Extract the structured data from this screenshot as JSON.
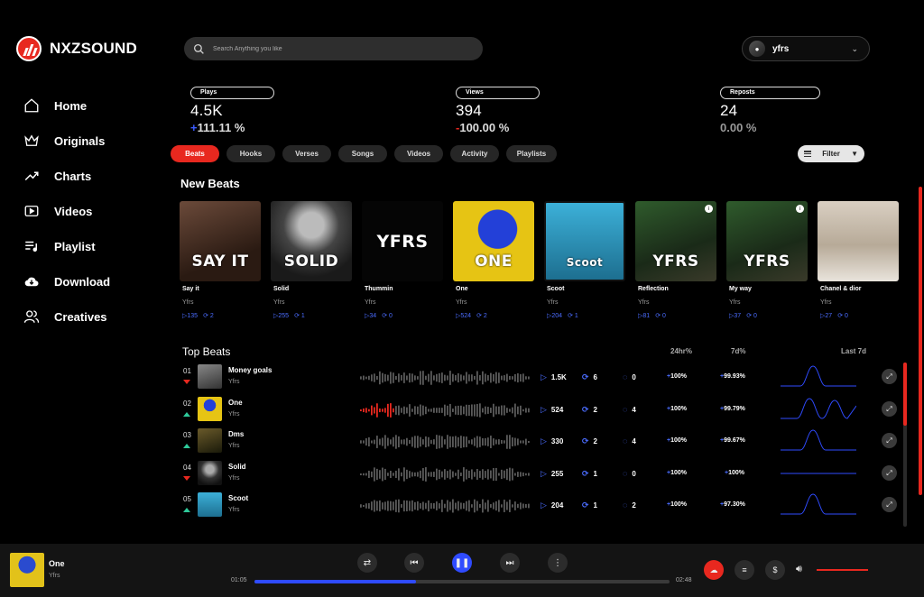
{
  "brand": {
    "name": "NXZSOUND",
    "accent": "#e8281f",
    "blue": "#2f4bff"
  },
  "nav": [
    {
      "label": "Home",
      "icon": "home-icon"
    },
    {
      "label": "Originals",
      "icon": "crown-icon"
    },
    {
      "label": "Charts",
      "icon": "trend-icon"
    },
    {
      "label": "Videos",
      "icon": "video-icon"
    },
    {
      "label": "Playlist",
      "icon": "playlist-icon"
    },
    {
      "label": "Download",
      "icon": "cloud-download-icon"
    },
    {
      "label": "Creatives",
      "icon": "people-icon"
    }
  ],
  "search": {
    "placeholder": "Search Anything you like"
  },
  "user": {
    "name": "yfrs"
  },
  "stats": [
    {
      "label": "Plays",
      "value": "4.5K",
      "sign": "+",
      "change": "111.11 %"
    },
    {
      "label": "Views",
      "value": "394",
      "sign": "-",
      "change": "100.00 %"
    },
    {
      "label": "Reposts",
      "value": "24",
      "sign": "",
      "change": "0.00 %"
    }
  ],
  "tabs": [
    "Beats",
    "Hooks",
    "Verses",
    "Songs",
    "Videos",
    "Activity",
    "Playlists"
  ],
  "active_tab": "Beats",
  "filter": {
    "label": "Filter"
  },
  "new_beats": {
    "title": "New Beats",
    "items": [
      {
        "title": "Say it",
        "artist": "Yfrs",
        "plays": "135",
        "reposts": "2",
        "cover_text": "SAY IT"
      },
      {
        "title": "Solid",
        "artist": "Yfrs",
        "plays": "255",
        "reposts": "1",
        "cover_text": "SOLID"
      },
      {
        "title": "Thummin",
        "artist": "Yfrs",
        "plays": "34",
        "reposts": "0",
        "cover_text": "YFRS"
      },
      {
        "title": "One",
        "artist": "Yfrs",
        "plays": "524",
        "reposts": "2",
        "cover_text": "ONE"
      },
      {
        "title": "Scoot",
        "artist": "Yfrs",
        "plays": "204",
        "reposts": "1",
        "cover_text": "Scoot"
      },
      {
        "title": "Reflection",
        "artist": "Yfrs",
        "plays": "81",
        "reposts": "0",
        "cover_text": "YFRS"
      },
      {
        "title": "My way",
        "artist": "Yfrs",
        "plays": "37",
        "reposts": "0",
        "cover_text": "YFRS"
      },
      {
        "title": "Chanel & dior",
        "artist": "Yfrs",
        "plays": "27",
        "reposts": "0",
        "cover_text": ""
      }
    ]
  },
  "top_beats": {
    "title": "Top Beats",
    "columns": {
      "h24": "24hr%",
      "d7": "7d%",
      "last7": "Last 7d"
    },
    "rows": [
      {
        "rank": "01",
        "trend": "down",
        "title": "Money goals",
        "artist": "Yfrs",
        "plays": "1.5K",
        "reposts": "6",
        "comments": "0",
        "h24": "100%",
        "d7": "99.93%",
        "progress": 0
      },
      {
        "rank": "02",
        "trend": "up",
        "title": "One",
        "artist": "Yfrs",
        "plays": "524",
        "reposts": "2",
        "comments": "4",
        "h24": "100%",
        "d7": "99.79%",
        "progress": 0.2
      },
      {
        "rank": "03",
        "trend": "up",
        "title": "Dms",
        "artist": "Yfrs",
        "plays": "330",
        "reposts": "2",
        "comments": "4",
        "h24": "100%",
        "d7": "99.67%",
        "progress": 0
      },
      {
        "rank": "04",
        "trend": "down",
        "title": "Solid",
        "artist": "Yfrs",
        "plays": "255",
        "reposts": "1",
        "comments": "0",
        "h24": "100%",
        "d7": "100%",
        "progress": 0
      },
      {
        "rank": "05",
        "trend": "up",
        "title": "Scoot",
        "artist": "Yfrs",
        "plays": "204",
        "reposts": "1",
        "comments": "2",
        "h24": "100%",
        "d7": "97.30%",
        "progress": 0
      }
    ]
  },
  "player": {
    "title": "One",
    "artist": "Yfrs",
    "elapsed": "01:05",
    "duration": "02:48",
    "progress": 0.39,
    "volume": 1.0
  }
}
